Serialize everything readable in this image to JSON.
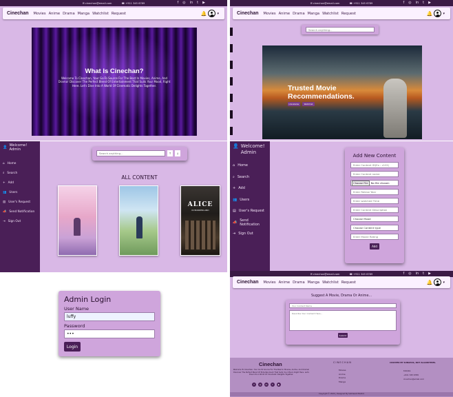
{
  "topbar": {
    "email": "✉ cinechan@email.com",
    "phone": "☎ +911 345 6789",
    "social_icons": [
      "facebook-icon",
      "instagram-icon",
      "linkedin-icon",
      "twitter-icon",
      "youtube-icon"
    ],
    "social_glyphs": [
      "f",
      "◎",
      "in",
      "t",
      "▶"
    ]
  },
  "nav": {
    "brand": "Cinechan",
    "links": [
      "Movies",
      "Anime",
      "Drama",
      "Manga",
      "Watchlist",
      "Request"
    ]
  },
  "hero": {
    "title": "What Is Cinechan?",
    "text": "Welcome To Cinechan, Your Go-To Source For The Best In Movies, Anime, And Drama! Discover The Perfect Blend Of Entertainment That Suits Your Mood, Right Here. Let's Dive Into A World Of Cinematic Delights Together."
  },
  "search": {
    "placeholder": "Search anything..."
  },
  "trusted": {
    "title": "Trusted Movie Recommendations.",
    "btn1": "Interstellar",
    "btn2": "Watchlist"
  },
  "admin_sidebar": {
    "greeting": "Welcome! Admin",
    "items": [
      {
        "icon": "home-icon",
        "glyph": "⌂",
        "label": "Home"
      },
      {
        "icon": "search-icon",
        "glyph": "⌕",
        "label": "Search"
      },
      {
        "icon": "plus-icon",
        "glyph": "+",
        "label": "Add"
      },
      {
        "icon": "users-icon",
        "glyph": "👥",
        "label": "Users"
      },
      {
        "icon": "request-icon",
        "glyph": "▤",
        "label": "User's Request"
      },
      {
        "icon": "megaphone-icon",
        "glyph": "📣",
        "label": "Send Notification"
      },
      {
        "icon": "signout-icon",
        "glyph": "⇥",
        "label": "Sign Out"
      }
    ]
  },
  "content": {
    "heading": "ALL CONTENT",
    "posters": [
      {
        "name": "Anime poster cherry blossom"
      },
      {
        "name": "A Silent Voice poster"
      },
      {
        "name": "Alice in Borderland poster",
        "title": "ALICE",
        "subtitle": "IN BORDERLAND"
      }
    ]
  },
  "login": {
    "title": "Admin Login",
    "user_label": "User Name",
    "user_value": "luffy",
    "pass_label": "Password",
    "pass_value": "•••",
    "button": "Login"
  },
  "add_content": {
    "title": "Add New Content",
    "fields": [
      "Enter Content ID(Ex : c101)",
      "Enter Content name",
      "Enter Relese Year",
      "Enter watched Time",
      "Enter Content Description",
      "Choose Mood",
      "Choose Content type",
      "Enter Movie Rating"
    ],
    "file_button": "Choose File",
    "file_text": "No file chosen",
    "submit": "Add"
  },
  "request": {
    "title": "Suggest A Movie, Drama Or Anime...",
    "name_placeholder": "Your Content Name",
    "desc_placeholder": "Describe Your Content Here...",
    "submit": "Submit"
  },
  "footer": {
    "brand": "Cinechan",
    "about": "Welcome To Cinechan, Your Go-To Source For The Best In Movies, Anime, And Drama! Discover The Perfect Blend Of Entertainment That Suits Your Mood, Right Here. Let's Dive Into A World Of Cinematic Delights Together.",
    "col2_title": "CINECHAN",
    "col2_links": [
      "Movies",
      "Anime",
      "Drama",
      "Manga"
    ],
    "col3_title": "CURATED BY SUBAHAS, NOT ALGORITHMS.",
    "col3_lines": [
      "Kolkata",
      "+911 345 6789",
      "cinechan@email.com"
    ],
    "copyright": "Copyright © 2024 | Designed By Subhasish Mallick"
  }
}
